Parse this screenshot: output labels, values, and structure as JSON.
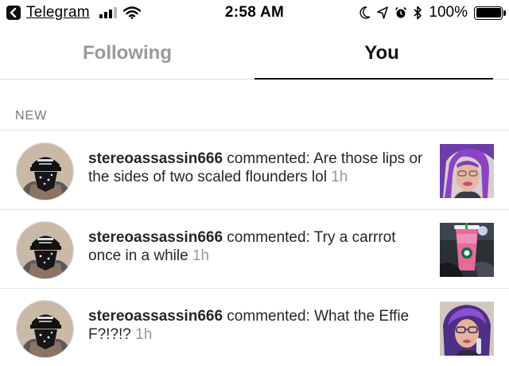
{
  "status_bar": {
    "back_app": "Telegram",
    "time": "2:58 AM",
    "battery_percent": "100%",
    "icons": [
      "back-icon",
      "signal-icon",
      "wifi-icon",
      "moon-icon",
      "location-icon",
      "alarm-icon",
      "bluetooth-icon",
      "battery-icon"
    ]
  },
  "tabs": [
    {
      "label": "Following",
      "active": false
    },
    {
      "label": "You",
      "active": true
    }
  ],
  "section": {
    "label": "NEW"
  },
  "notifications": [
    {
      "username": "stereoassassin666",
      "action": " commented: Are those lips or the sides of two scaled flounders lol ",
      "time": "1h",
      "thumb": "purple-hair-selfie"
    },
    {
      "username": "stereoassassin666",
      "action": " commented: Try a carrrot once in a while ",
      "time": "1h",
      "thumb": "pink-drink-cup"
    },
    {
      "username": "stereoassassin666",
      "action": " commented: What the Effie F?!?!? ",
      "time": "1h",
      "thumb": "purple-hair-glasses-selfie"
    }
  ]
}
